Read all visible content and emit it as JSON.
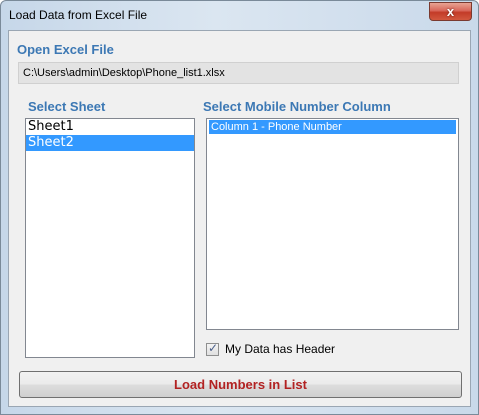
{
  "window": {
    "title": "Load Data from Excel File",
    "close_glyph": "x"
  },
  "open_file": {
    "label": "Open Excel File",
    "path": "C:\\Users\\admin\\Desktop\\Phone_list1.xlsx"
  },
  "select_sheet": {
    "label": "Select Sheet",
    "items": [
      {
        "label": "Sheet1",
        "selected": false
      },
      {
        "label": "Sheet2",
        "selected": true
      }
    ]
  },
  "select_column": {
    "label": "Select Mobile Number Column",
    "items": [
      {
        "label": "Column 1 - Phone Number",
        "selected": true
      }
    ]
  },
  "header_option": {
    "label": "My Data has Header",
    "checked": true
  },
  "load_button": {
    "label": "Load Numbers in List"
  },
  "colors": {
    "section_label": "#3c78b4",
    "button_text": "#b22222",
    "selection": "#3399ff"
  }
}
